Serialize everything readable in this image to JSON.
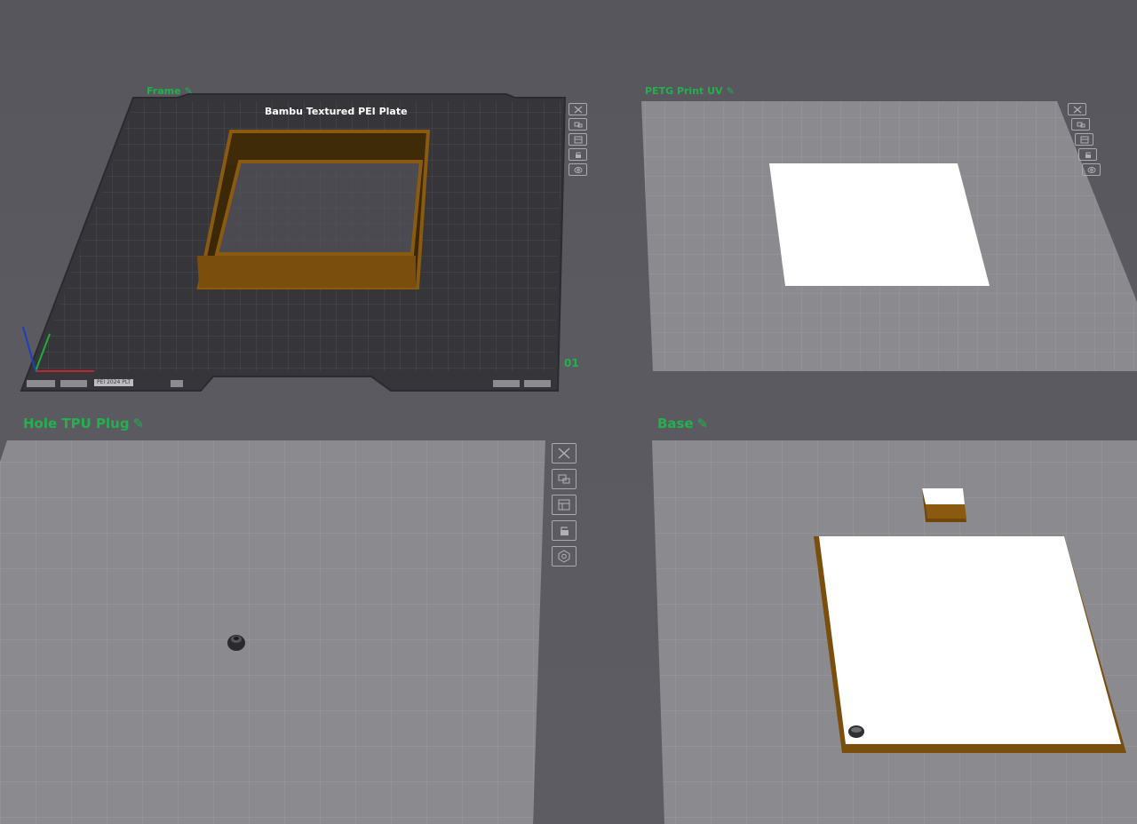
{
  "plates": [
    {
      "id": "frame",
      "name": "Frame",
      "plate_type": "Bambu Textured PEI Plate",
      "plate_number": "01",
      "tag": "PEI 2024 PLT"
    },
    {
      "id": "petg",
      "name": "PETG Print UV"
    },
    {
      "id": "hole",
      "name": "Hole TPU Plug"
    },
    {
      "id": "base",
      "name": "Base"
    }
  ],
  "plate_tools": [
    "close-icon",
    "arrange-icon",
    "orient-icon",
    "lock-icon",
    "settings-icon"
  ],
  "colors": {
    "label_green": "#22b14c",
    "active_plate": "#3a3a3e",
    "inactive_plate": "#8c8c90",
    "model_orange": "#8a5a10",
    "model_dark": "#3a2806",
    "model_white": "#ffffff"
  }
}
